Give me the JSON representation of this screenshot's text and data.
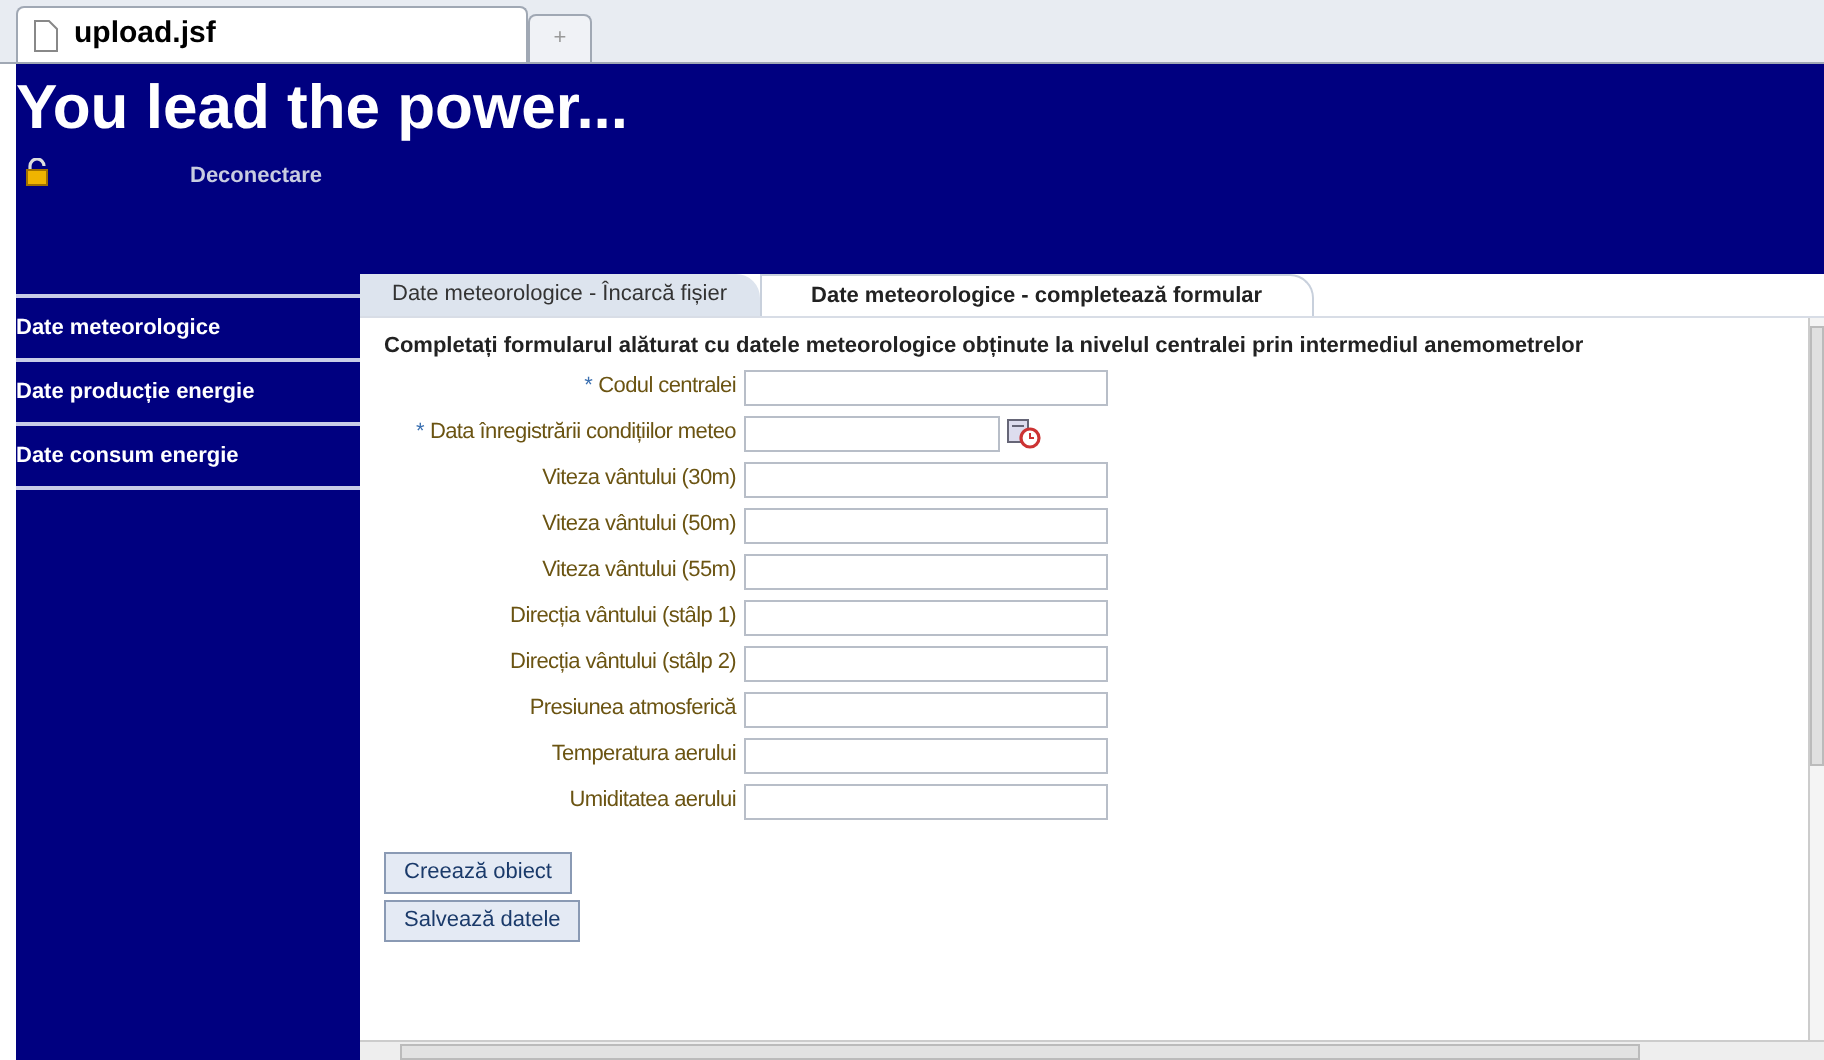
{
  "browser_tab": {
    "title": "upload.jsf",
    "new_tab": "+"
  },
  "header": {
    "title": "You lead the power...",
    "logout": "Deconectare"
  },
  "sidebar": {
    "items": [
      {
        "label": "Date meteorologice"
      },
      {
        "label": "Date producție energie"
      },
      {
        "label": "Date consum energie"
      }
    ]
  },
  "tabs": [
    {
      "label": "Date meteorologice - Încarcă fișier",
      "selected": false
    },
    {
      "label": "Date meteorologice - completează formular",
      "selected": true
    }
  ],
  "form": {
    "instructions": "Completați formularul alăturat cu datele meteorologice obținute la nivelul centralei prin intermediul anemometrelor",
    "fields": [
      {
        "label": "Codul centralei",
        "required": true,
        "kind": "text"
      },
      {
        "label": "Data înregistrării condițiilor meteo",
        "required": true,
        "kind": "date"
      },
      {
        "label": "Viteza vântului (30m)",
        "required": false,
        "kind": "text"
      },
      {
        "label": "Viteza vântului (50m)",
        "required": false,
        "kind": "text"
      },
      {
        "label": "Viteza vântului (55m)",
        "required": false,
        "kind": "text"
      },
      {
        "label": "Direcția vântului (stâlp 1)",
        "required": false,
        "kind": "text"
      },
      {
        "label": "Direcția vântului (stâlp 2)",
        "required": false,
        "kind": "text"
      },
      {
        "label": "Presiunea atmosferică",
        "required": false,
        "kind": "text"
      },
      {
        "label": "Temperatura aerului",
        "required": false,
        "kind": "text"
      },
      {
        "label": "Umiditatea aerului",
        "required": false,
        "kind": "text"
      }
    ],
    "required_mark": "*",
    "buttons": [
      "Creează obiect",
      "Salvează datele"
    ]
  }
}
